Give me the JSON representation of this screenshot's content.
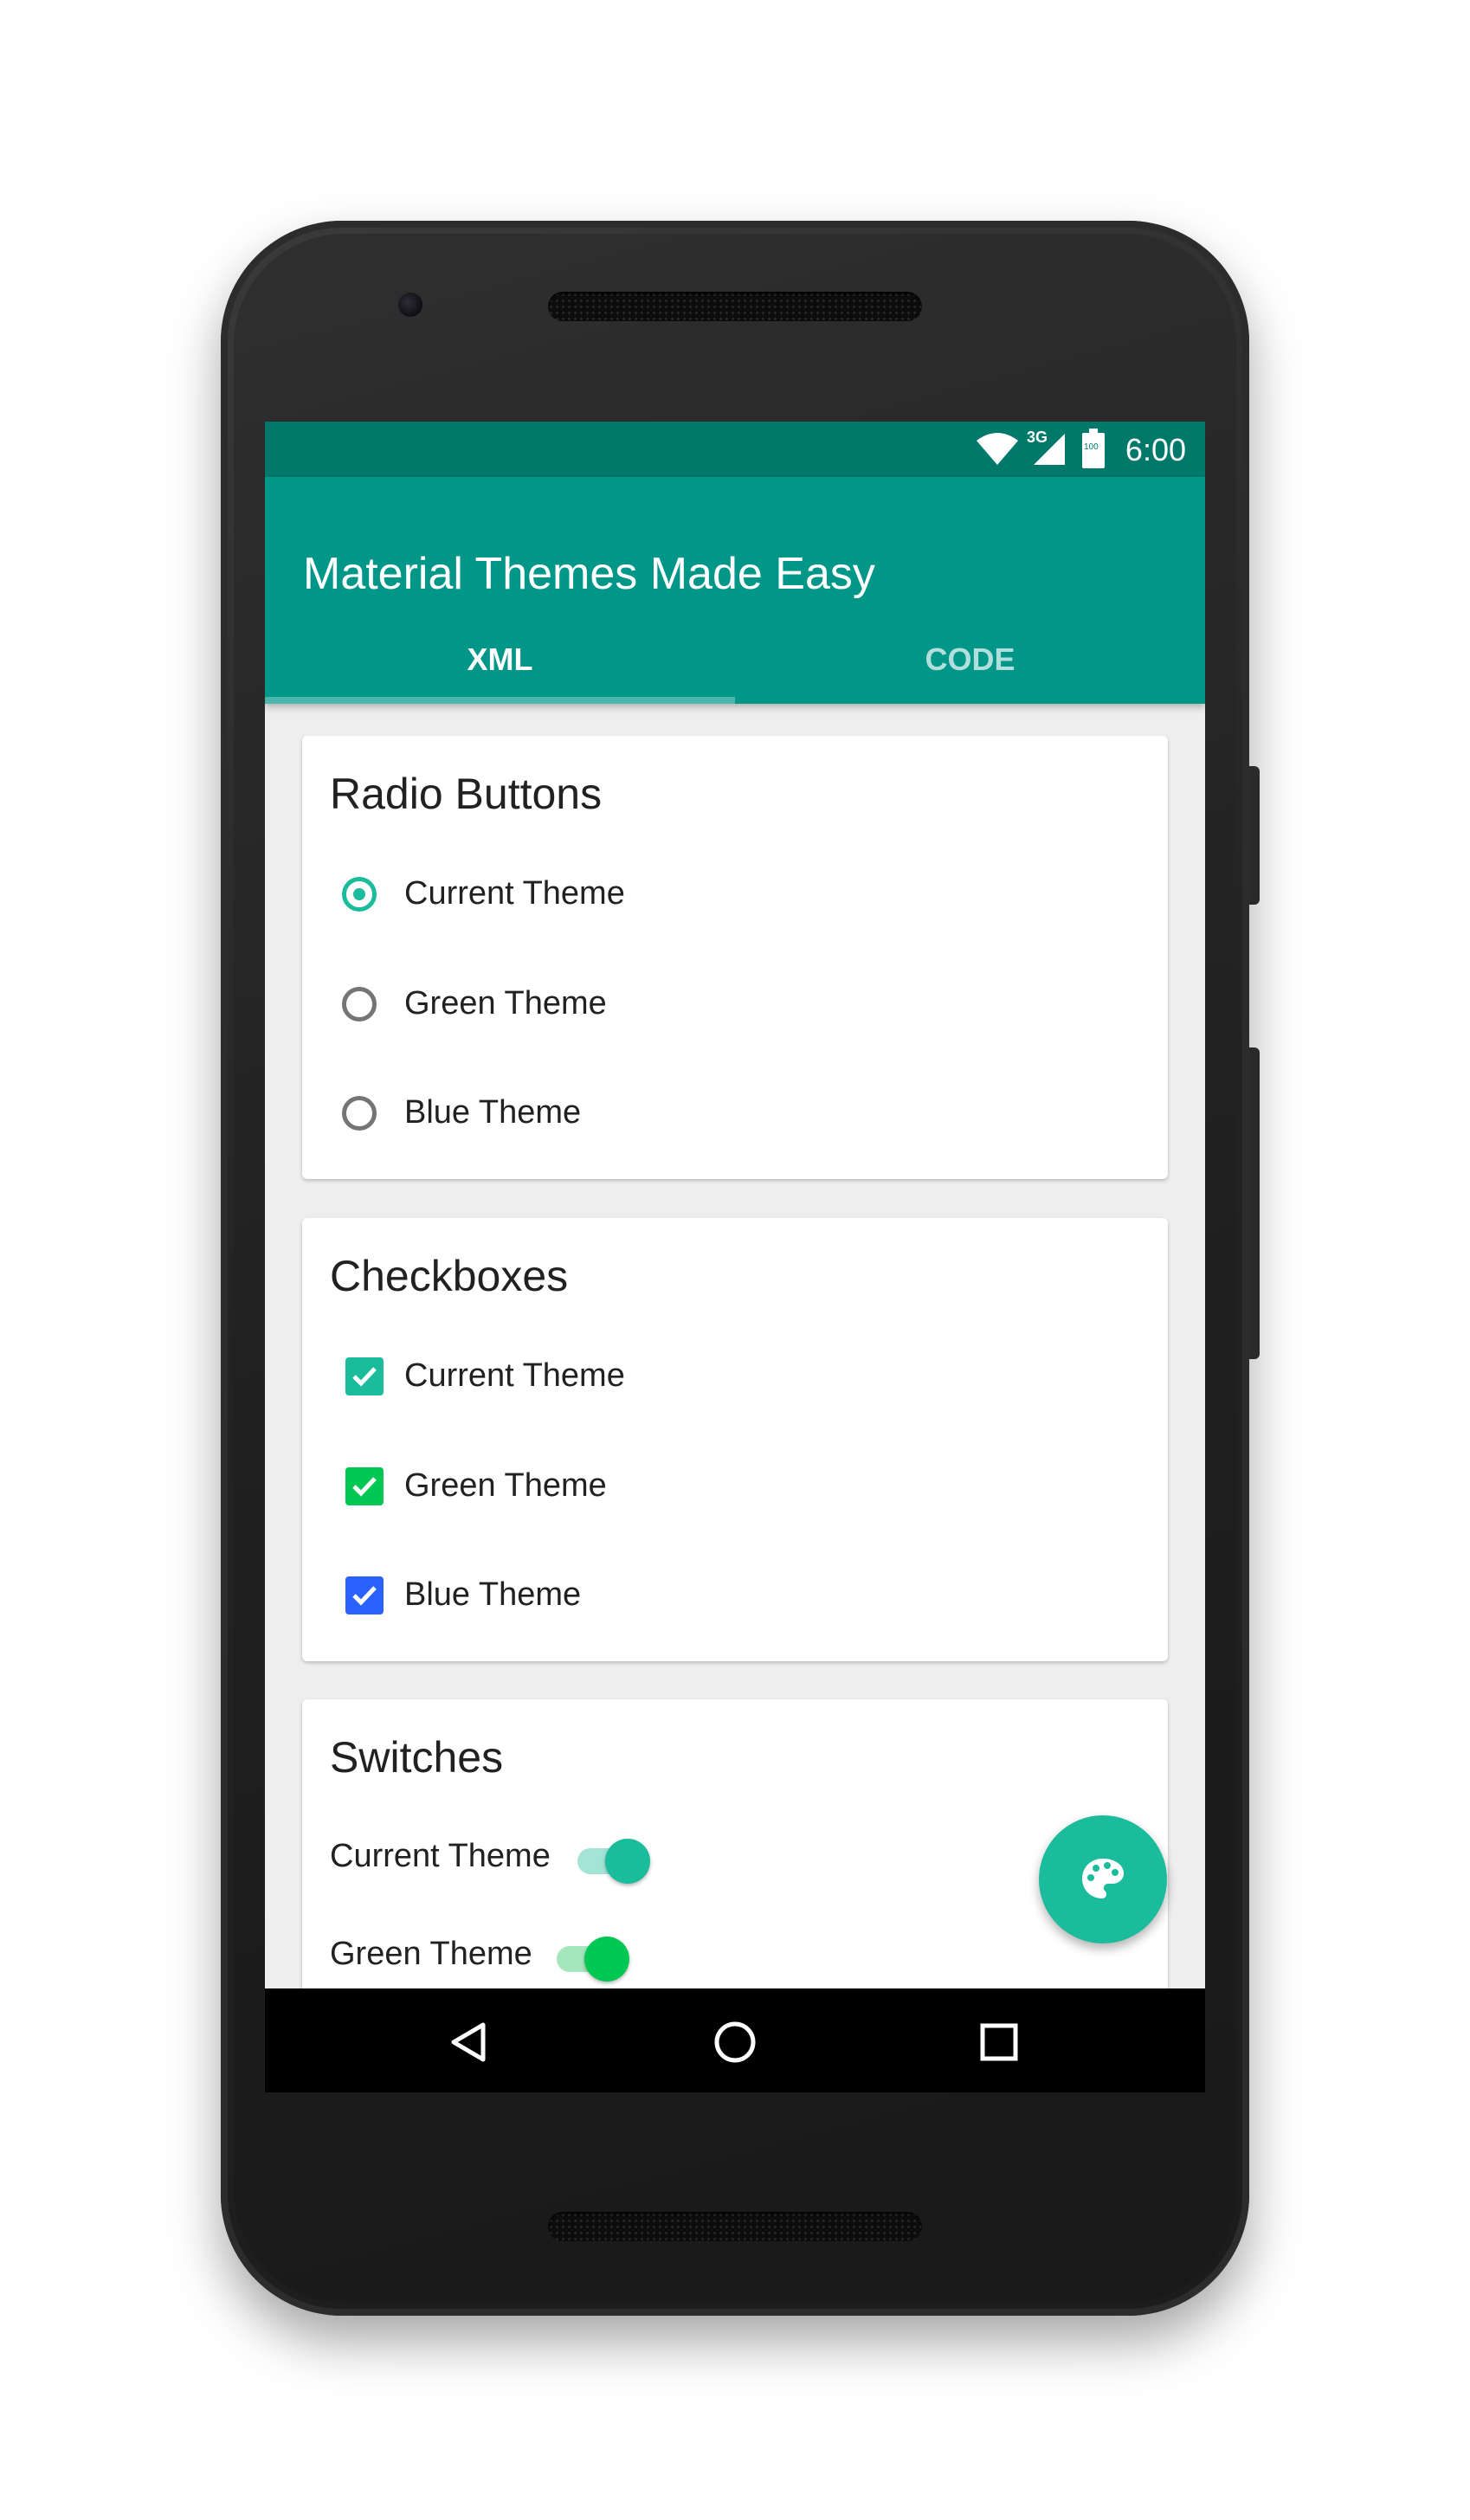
{
  "status_bar": {
    "time": "6:00",
    "network": "3G",
    "battery": "100"
  },
  "app_bar": {
    "title": "Material Themes Made Easy",
    "tabs": [
      {
        "label": "XML",
        "selected": true
      },
      {
        "label": "CODE",
        "selected": false
      }
    ]
  },
  "radio_card": {
    "title": "Radio Buttons",
    "options": [
      {
        "label": "Current Theme",
        "checked": true
      },
      {
        "label": "Green Theme",
        "checked": false
      },
      {
        "label": "Blue Theme",
        "checked": false
      }
    ]
  },
  "checkbox_card": {
    "title": "Checkboxes",
    "options": [
      {
        "label": "Current Theme",
        "checked": true,
        "color": "#1abc9c"
      },
      {
        "label": "Green Theme",
        "checked": true,
        "color": "#00c853"
      },
      {
        "label": "Blue Theme",
        "checked": true,
        "color": "#2962ff"
      }
    ]
  },
  "switch_card": {
    "title": "Switches",
    "options": [
      {
        "label": "Current Theme",
        "on": true,
        "color": "#1abc9c"
      },
      {
        "label": "Green Theme",
        "on": true,
        "color": "#00c853"
      }
    ]
  },
  "fab": {
    "icon": "palette-icon"
  },
  "nav_bar": {
    "icons": [
      "back-icon",
      "home-icon",
      "recents-icon"
    ]
  },
  "colors": {
    "primary": "#009688",
    "primary_dark": "#00796b",
    "accent": "#1abc9c"
  }
}
